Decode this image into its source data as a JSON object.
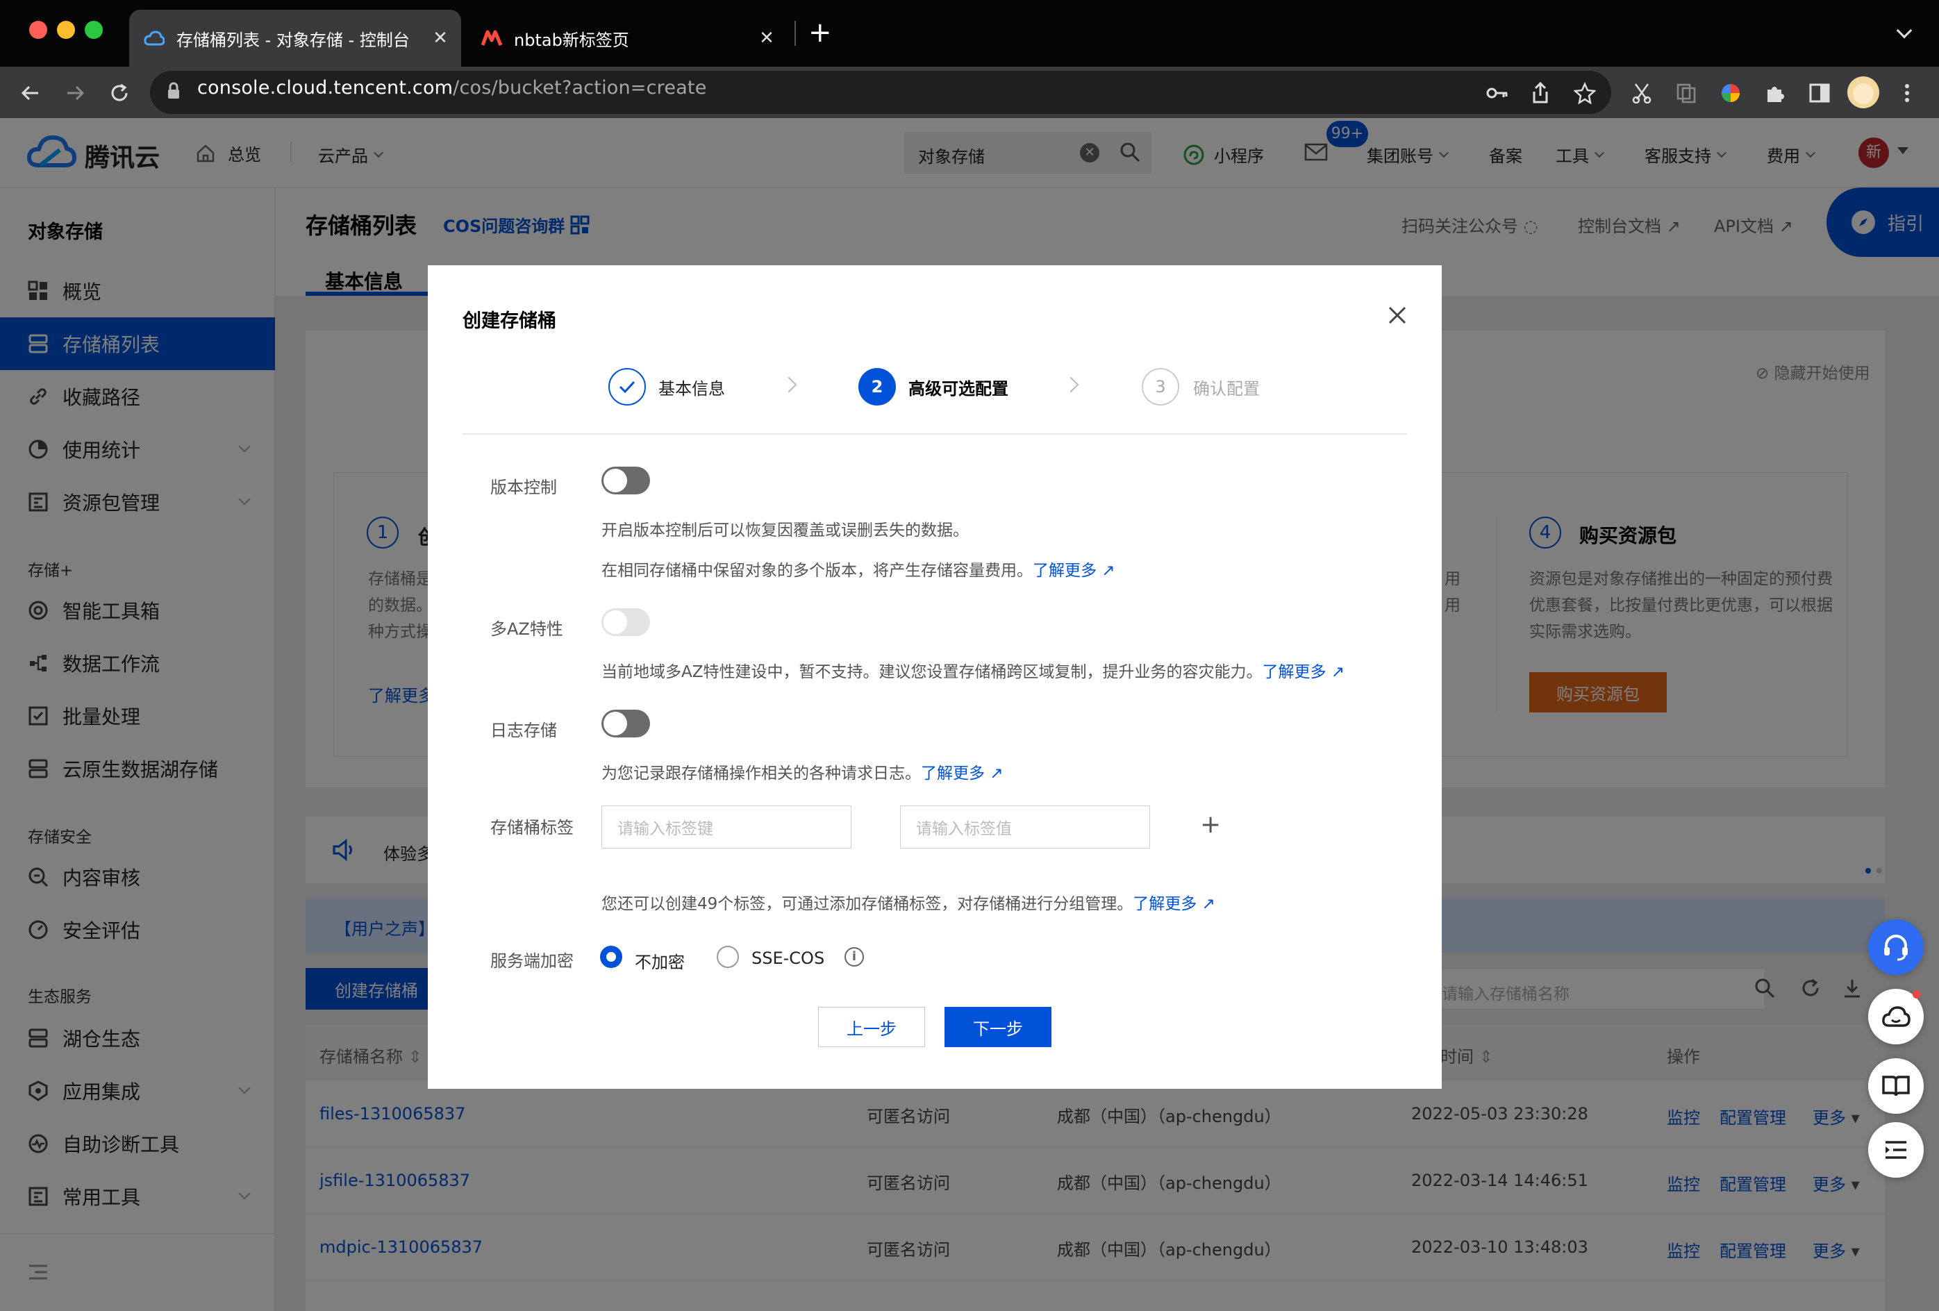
{
  "browser": {
    "tabs": [
      {
        "title": "存储桶列表 - 对象存储 - 控制台",
        "active": true
      },
      {
        "title": "nbtab新标签页",
        "active": false
      }
    ],
    "new_tab": "+",
    "url_host": "console.cloud.tencent.com",
    "url_path": "/cos/bucket?action=create"
  },
  "header": {
    "brand": "腾讯云",
    "home": "总览",
    "products": "云产品",
    "search_value": "对象存储",
    "mini_program": "小程序",
    "mail_badge": "99+",
    "group_account": "集团账号",
    "filing": "备案",
    "tools": "工具",
    "support": "客服支持",
    "fees": "费用",
    "avatar_text": "新"
  },
  "sidebar": {
    "title": "对象存储",
    "items": [
      {
        "label": "概览",
        "icon": "grid-icon"
      },
      {
        "label": "存储桶列表",
        "icon": "bucket-icon",
        "active": true
      },
      {
        "label": "收藏路径",
        "icon": "link-icon"
      },
      {
        "label": "使用统计",
        "icon": "pie-chart-icon",
        "expand": true
      },
      {
        "label": "资源包管理",
        "icon": "package-icon",
        "expand": true
      }
    ],
    "sections": [
      {
        "title": "存储+",
        "items": [
          {
            "label": "智能工具箱",
            "icon": "toolbox-icon"
          },
          {
            "label": "数据工作流",
            "icon": "workflow-icon"
          },
          {
            "label": "批量处理",
            "icon": "batch-icon"
          },
          {
            "label": "云原生数据湖存储",
            "icon": "datalake-icon"
          }
        ]
      },
      {
        "title": "存储安全",
        "items": [
          {
            "label": "内容审核",
            "icon": "audit-icon"
          },
          {
            "label": "安全评估",
            "icon": "security-icon"
          }
        ]
      },
      {
        "title": "生态服务",
        "items": [
          {
            "label": "湖仓生态",
            "icon": "lakehouse-icon"
          },
          {
            "label": "应用集成",
            "icon": "integration-icon",
            "expand": true
          },
          {
            "label": "自助诊断工具",
            "icon": "diagnosis-icon"
          },
          {
            "label": "常用工具",
            "icon": "tools-icon",
            "expand": true
          }
        ]
      }
    ]
  },
  "page": {
    "title": "存储桶列表",
    "cos_group": "COS问题咨询群",
    "follow": "扫码关注公众号",
    "console_docs": "控制台文档",
    "api_docs": "API文档",
    "guide": "指引",
    "tab": "基本信息",
    "hide_start": "隐藏开始使用",
    "step1_num": "1",
    "step1_title_frag": "创",
    "step1_desc": [
      "存储桶是",
      "的数据。",
      "种方式操"
    ],
    "step1_link": "了解更多",
    "step4_num": "4",
    "step4_title": "购买资源包",
    "step4_desc": [
      "资源包是对象存储推出的一种固定的预付费",
      "优惠套餐，比按量付费比更优惠，可以根据",
      "实际需求选购。"
    ],
    "step4_partial": [
      "用",
      "用"
    ],
    "buy_button": "购买资源包",
    "notice": "体验多",
    "user_voice": "【用户之声】",
    "create_button": "创建存储桶",
    "search_placeholder": "请输入存储桶名称",
    "table": {
      "headers": {
        "name": "存储桶名称",
        "time": "时间",
        "ops": "操作"
      },
      "rows": [
        {
          "name": "files-1310065837",
          "access": "可匿名访问",
          "region": "成都（中国）（ap-chengdu）",
          "time": "2022-05-03 23:30:28"
        },
        {
          "name": "jsfile-1310065837",
          "access": "可匿名访问",
          "region": "成都（中国）（ap-chengdu）",
          "time": "2022-03-14 14:46:51"
        },
        {
          "name": "mdpic-1310065837",
          "access": "可匿名访问",
          "region": "成都（中国）（ap-chengdu）",
          "time": "2022-03-10 13:48:03"
        }
      ],
      "ops": {
        "monitor": "监控",
        "config": "配置管理",
        "more": "更多"
      }
    }
  },
  "modal": {
    "title": "创建存储桶",
    "steps": [
      {
        "num": "",
        "label": "基本信息",
        "state": "done"
      },
      {
        "num": "2",
        "label": "高级可选配置",
        "state": "active"
      },
      {
        "num": "3",
        "label": "确认配置",
        "state": "pending"
      }
    ],
    "versioning": {
      "label": "版本控制",
      "enabled": false,
      "desc1": "开启版本控制后可以恢复因覆盖或误删丢失的数据。",
      "desc2": "在相同存储桶中保留对象的多个版本，将产生存储容量费用。",
      "link": "了解更多"
    },
    "multi_az": {
      "label": "多AZ特性",
      "enabled": false,
      "disabled": true,
      "desc": "当前地域多AZ特性建设中，暂不支持。建议您设置存储桶跨区域复制，提升业务的容灾能力。",
      "link": "了解更多"
    },
    "logging": {
      "label": "日志存储",
      "enabled": false,
      "desc": "为您记录跟存储桶操作相关的各种请求日志。",
      "link": "了解更多"
    },
    "tags": {
      "label": "存储桶标签",
      "key_placeholder": "请输入标签键",
      "value_placeholder": "请输入标签值",
      "add": "+",
      "desc": "您还可以创建49个标签，可通过添加存储桶标签，对存储桶进行分组管理。",
      "link": "了解更多"
    },
    "encryption": {
      "label": "服务端加密",
      "options": [
        "不加密",
        "SSE-COS"
      ],
      "selected": "不加密"
    },
    "prev": "上一步",
    "next": "下一步"
  },
  "colors": {
    "primary": "#0052d9",
    "buy": "#c9520f",
    "sidebar_active": "#0052d9",
    "badge": "#0052d9"
  }
}
